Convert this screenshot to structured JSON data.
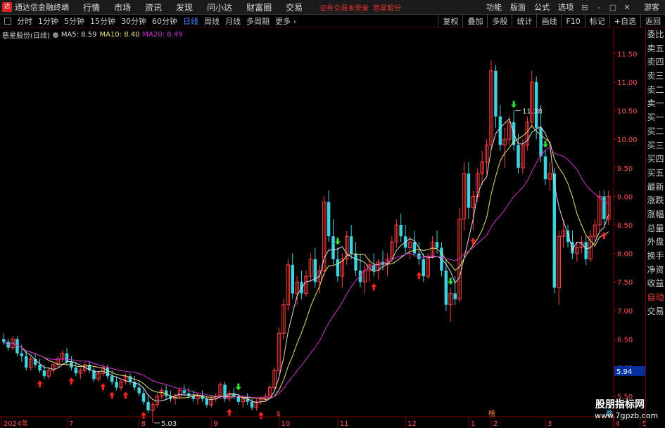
{
  "titlebar": {
    "app_title": "通达信金融终端",
    "logo": "达",
    "menu": [
      "行情",
      "市场",
      "资讯",
      "发现",
      "问小达",
      "财富圈",
      "交易"
    ],
    "security_status": "证券交易未登录",
    "stock_title": "慈星股份",
    "right_menu": [
      "功能",
      "版面",
      "公式",
      "选项"
    ],
    "guest": "游客"
  },
  "periodbar": {
    "periods": [
      "分时",
      "1分钟",
      "5分钟",
      "15分钟",
      "30分钟",
      "60分钟",
      "日线",
      "周线",
      "月线",
      "多周期",
      "更多"
    ],
    "active": "日线",
    "tools": [
      "复权",
      "叠加",
      "多股",
      "统计",
      "画线",
      "F10",
      "标记",
      "+自选",
      "返回"
    ]
  },
  "legend": {
    "name": "慈星股份(日线)",
    "ma5": "MA5: 8.59",
    "ma10": "MA10: 8.40",
    "ma20": "MA20: 8.49"
  },
  "sidepanel": {
    "items": [
      "委比",
      "卖五",
      "卖四",
      "卖三",
      "卖二",
      "卖一",
      "买一",
      "买二",
      "买三",
      "买四",
      "买五",
      "最新",
      "涨跌",
      "涨幅",
      "总量",
      "外盘",
      "换手",
      "净资",
      "收益",
      "自动",
      "交易"
    ]
  },
  "watermark": {
    "line1": "股朋指标网",
    "line2": "www.7gpzb.com"
  },
  "colors": {
    "up": "#ff4040",
    "down": "#40d0e0",
    "ma5": "#dddddd",
    "ma10": "#e8e070",
    "ma20": "#d030d0",
    "arrow_up": "#ff2020",
    "arrow_down": "#30e030"
  },
  "chart_data": {
    "type": "candlestick",
    "y_ticks": [
      11.5,
      11.0,
      10.5,
      10.0,
      9.5,
      9.0,
      8.5,
      8.0,
      7.5,
      7.0,
      6.5,
      6.0,
      5.5
    ],
    "ylim": [
      5.2,
      11.8
    ],
    "current_price": "5.94",
    "max_label": "11.38",
    "min_label": "5.03",
    "x_labels": [
      "2024年",
      "7",
      "8",
      "9",
      "10",
      "11",
      "12",
      "1",
      "2",
      "3",
      "4",
      "5"
    ],
    "event_markers": [
      {
        "label": "$"
      },
      {
        "label": "榜"
      },
      {
        "label": "跌"
      },
      {
        "label": "财"
      }
    ],
    "ohlc": [
      [
        6.5,
        6.6,
        6.4,
        6.45
      ],
      [
        6.45,
        6.5,
        6.3,
        6.35
      ],
      [
        6.35,
        6.55,
        6.3,
        6.5
      ],
      [
        6.5,
        6.55,
        6.2,
        6.25
      ],
      [
        6.25,
        6.4,
        6.1,
        6.2
      ],
      [
        6.2,
        6.3,
        5.95,
        6.0
      ],
      [
        6.0,
        6.2,
        5.95,
        6.15
      ],
      [
        6.15,
        6.25,
        6.0,
        6.05
      ],
      [
        6.05,
        6.15,
        5.9,
        5.95
      ],
      [
        5.95,
        6.05,
        5.8,
        5.85
      ],
      [
        5.85,
        6.0,
        5.8,
        5.95
      ],
      [
        5.95,
        6.1,
        5.9,
        6.05
      ],
      [
        6.05,
        6.2,
        6.0,
        6.15
      ],
      [
        6.15,
        6.3,
        6.1,
        6.25
      ],
      [
        6.25,
        6.35,
        6.05,
        6.1
      ],
      [
        6.1,
        6.2,
        5.95,
        6.0
      ],
      [
        6.0,
        6.1,
        5.85,
        5.9
      ],
      [
        5.9,
        6.0,
        5.8,
        5.95
      ],
      [
        5.95,
        6.1,
        5.9,
        6.05
      ],
      [
        6.05,
        6.1,
        5.9,
        5.95
      ],
      [
        5.95,
        6.0,
        5.75,
        5.8
      ],
      [
        5.8,
        5.95,
        5.75,
        5.9
      ],
      [
        5.9,
        6.05,
        5.85,
        6.0
      ],
      [
        6.0,
        6.05,
        5.8,
        5.85
      ],
      [
        5.85,
        5.95,
        5.7,
        5.75
      ],
      [
        5.75,
        5.85,
        5.6,
        5.65
      ],
      [
        5.65,
        5.8,
        5.6,
        5.75
      ],
      [
        5.75,
        5.9,
        5.7,
        5.85
      ],
      [
        5.85,
        5.9,
        5.7,
        5.75
      ],
      [
        5.75,
        5.85,
        5.6,
        5.65
      ],
      [
        5.65,
        5.75,
        5.5,
        5.55
      ],
      [
        5.55,
        5.65,
        5.35,
        5.4
      ],
      [
        5.4,
        5.5,
        5.2,
        5.25
      ],
      [
        5.25,
        5.4,
        5.03,
        5.35
      ],
      [
        5.35,
        5.55,
        5.3,
        5.5
      ],
      [
        5.5,
        5.65,
        5.45,
        5.6
      ],
      [
        5.6,
        5.7,
        5.45,
        5.5
      ],
      [
        5.5,
        5.6,
        5.4,
        5.45
      ],
      [
        5.45,
        5.55,
        5.35,
        5.5
      ],
      [
        5.5,
        5.65,
        5.45,
        5.6
      ],
      [
        5.6,
        5.7,
        5.5,
        5.55
      ],
      [
        5.55,
        5.65,
        5.45,
        5.5
      ],
      [
        5.5,
        5.6,
        5.4,
        5.45
      ],
      [
        5.45,
        5.55,
        5.35,
        5.5
      ],
      [
        5.5,
        5.6,
        5.4,
        5.45
      ],
      [
        5.45,
        5.5,
        5.3,
        5.35
      ],
      [
        5.35,
        5.5,
        5.3,
        5.45
      ],
      [
        5.45,
        5.55,
        5.4,
        5.5
      ],
      [
        5.5,
        5.75,
        5.45,
        5.7
      ],
      [
        5.7,
        5.75,
        5.4,
        5.45
      ],
      [
        5.45,
        5.6,
        5.4,
        5.55
      ],
      [
        5.55,
        5.65,
        5.45,
        5.5
      ],
      [
        5.5,
        5.55,
        5.35,
        5.4
      ],
      [
        5.4,
        5.5,
        5.3,
        5.45
      ],
      [
        5.45,
        5.55,
        5.35,
        5.4
      ],
      [
        5.4,
        5.45,
        5.25,
        5.3
      ],
      [
        5.3,
        5.45,
        5.25,
        5.4
      ],
      [
        5.4,
        5.5,
        5.35,
        5.45
      ],
      [
        5.45,
        5.55,
        5.4,
        5.5
      ],
      [
        5.5,
        5.7,
        5.45,
        5.65
      ],
      [
        5.65,
        6.0,
        5.6,
        5.95
      ],
      [
        5.95,
        6.7,
        5.9,
        6.6
      ],
      [
        6.6,
        7.2,
        6.5,
        7.1
      ],
      [
        7.1,
        7.9,
        7.0,
        7.8
      ],
      [
        7.8,
        8.0,
        7.2,
        7.3
      ],
      [
        7.3,
        7.6,
        7.1,
        7.5
      ],
      [
        7.5,
        7.7,
        7.2,
        7.3
      ],
      [
        7.3,
        7.7,
        7.25,
        7.6
      ],
      [
        7.6,
        8.0,
        7.5,
        7.9
      ],
      [
        7.9,
        8.1,
        7.4,
        7.5
      ],
      [
        7.5,
        7.8,
        7.3,
        7.7
      ],
      [
        7.7,
        9.0,
        7.6,
        8.9
      ],
      [
        8.9,
        9.1,
        8.2,
        8.3
      ],
      [
        8.3,
        8.6,
        7.8,
        7.9
      ],
      [
        7.9,
        8.1,
        7.5,
        7.6
      ],
      [
        7.6,
        8.0,
        7.4,
        7.9
      ],
      [
        7.9,
        8.4,
        7.8,
        8.3
      ],
      [
        8.3,
        8.5,
        7.9,
        8.0
      ],
      [
        8.0,
        8.2,
        7.6,
        7.7
      ],
      [
        7.7,
        8.0,
        7.4,
        7.5
      ],
      [
        7.5,
        7.8,
        7.3,
        7.7
      ],
      [
        7.7,
        7.9,
        7.5,
        7.8
      ],
      [
        7.8,
        8.0,
        7.6,
        7.7
      ],
      [
        7.7,
        7.9,
        7.55,
        7.85
      ],
      [
        7.85,
        8.05,
        7.7,
        7.8
      ],
      [
        7.8,
        8.0,
        7.6,
        7.9
      ],
      [
        7.9,
        8.3,
        7.85,
        8.2
      ],
      [
        8.2,
        8.6,
        8.1,
        8.5
      ],
      [
        8.5,
        8.7,
        8.2,
        8.3
      ],
      [
        8.3,
        8.5,
        8.0,
        8.1
      ],
      [
        8.1,
        8.3,
        7.9,
        8.2
      ],
      [
        8.2,
        8.4,
        7.95,
        8.0
      ],
      [
        8.0,
        8.2,
        7.8,
        7.9
      ],
      [
        7.9,
        8.0,
        7.5,
        7.6
      ],
      [
        7.6,
        8.0,
        7.55,
        7.95
      ],
      [
        7.95,
        8.3,
        7.9,
        8.2
      ],
      [
        8.2,
        8.4,
        8.0,
        8.1
      ],
      [
        8.1,
        8.2,
        7.6,
        7.7
      ],
      [
        7.7,
        7.9,
        7.0,
        7.1
      ],
      [
        7.1,
        7.4,
        6.8,
        7.3
      ],
      [
        7.3,
        7.6,
        7.1,
        7.2
      ],
      [
        7.2,
        8.8,
        7.15,
        8.6
      ],
      [
        8.6,
        9.6,
        8.4,
        9.4
      ],
      [
        9.4,
        9.6,
        8.6,
        8.8
      ],
      [
        8.8,
        9.1,
        8.4,
        9.0
      ],
      [
        9.0,
        9.5,
        8.9,
        9.4
      ],
      [
        9.4,
        9.8,
        9.2,
        9.6
      ],
      [
        9.6,
        10.0,
        9.4,
        9.9
      ],
      [
        9.9,
        11.38,
        9.8,
        11.2
      ],
      [
        11.2,
        11.3,
        10.2,
        10.4
      ],
      [
        10.4,
        10.6,
        9.8,
        9.9
      ],
      [
        9.9,
        10.2,
        9.5,
        10.0
      ],
      [
        10.0,
        10.4,
        9.9,
        10.3
      ],
      [
        10.3,
        10.5,
        9.8,
        9.9
      ],
      [
        9.9,
        10.1,
        9.4,
        9.5
      ],
      [
        9.5,
        10.0,
        9.4,
        9.9
      ],
      [
        9.9,
        10.4,
        9.8,
        10.3
      ],
      [
        10.3,
        11.2,
        10.2,
        11.0
      ],
      [
        11.0,
        11.1,
        10.0,
        10.2
      ],
      [
        10.2,
        10.6,
        9.6,
        9.7
      ],
      [
        9.7,
        9.8,
        9.2,
        9.3
      ],
      [
        9.3,
        9.6,
        9.1,
        9.4
      ],
      [
        9.4,
        9.5,
        7.3,
        7.4
      ],
      [
        7.4,
        8.4,
        7.1,
        8.3
      ],
      [
        8.3,
        8.6,
        8.1,
        8.4
      ],
      [
        8.4,
        8.5,
        8.1,
        8.2
      ],
      [
        8.2,
        8.4,
        7.9,
        8.0
      ],
      [
        8.0,
        8.2,
        7.85,
        8.1
      ],
      [
        8.1,
        8.3,
        8.0,
        8.2
      ],
      [
        8.2,
        8.3,
        7.8,
        7.9
      ],
      [
        7.9,
        8.4,
        7.85,
        8.3
      ],
      [
        8.3,
        8.6,
        8.2,
        8.5
      ],
      [
        8.5,
        9.1,
        8.4,
        9.0
      ],
      [
        9.0,
        9.1,
        8.5,
        8.6
      ],
      [
        8.6,
        9.1,
        8.5,
        9.0
      ]
    ],
    "x_label_bars": [
      0,
      14,
      30,
      46,
      61,
      74,
      89,
      103,
      108,
      120,
      135,
      141
    ],
    "arrows_up": [
      8,
      15,
      22,
      24,
      27,
      31,
      50,
      57,
      82,
      92,
      104,
      133,
      139
    ],
    "arrows_down": [
      52,
      74,
      99,
      113,
      120,
      142
    ],
    "max_bar": 113,
    "min_bar": 33
  }
}
